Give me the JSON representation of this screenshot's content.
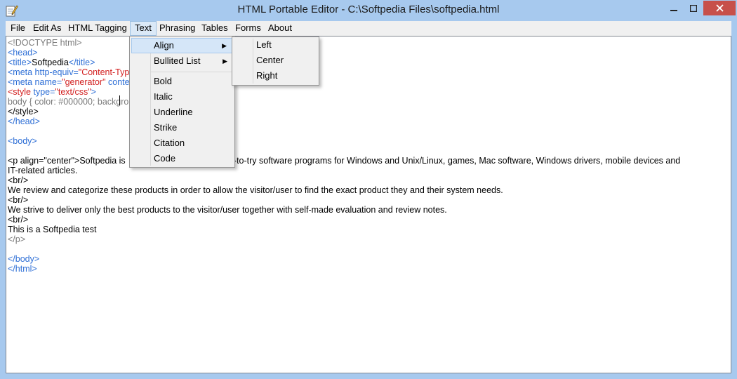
{
  "window": {
    "title": "HTML Portable Editor - C:\\Softpedia Files\\softpedia.html"
  },
  "menubar": {
    "items": [
      {
        "label": "File"
      },
      {
        "label": "Edit As"
      },
      {
        "label": "HTML Tagging"
      },
      {
        "label": "Text"
      },
      {
        "label": "Phrasing"
      },
      {
        "label": "Tables"
      },
      {
        "label": "Forms"
      },
      {
        "label": "About"
      }
    ]
  },
  "text_menu": {
    "items": [
      {
        "label": "Align",
        "arrow": "▶"
      },
      {
        "label": "Bullited List",
        "arrow": "▶"
      },
      {
        "label": "Bold"
      },
      {
        "label": "Italic"
      },
      {
        "label": "Underline"
      },
      {
        "label": "Strike"
      },
      {
        "label": "Citation"
      },
      {
        "label": "Code"
      }
    ]
  },
  "align_menu": {
    "items": [
      {
        "label": "Left"
      },
      {
        "label": "Center"
      },
      {
        "label": "Right"
      }
    ]
  },
  "editor": {
    "lines": [
      [
        {
          "t": "<!DOCTYPE html>",
          "c": "gray"
        }
      ],
      [
        {
          "t": "<head>",
          "c": "blue"
        }
      ],
      [
        {
          "t": "<title>",
          "c": "blue"
        },
        {
          "t": "Softpedia",
          "c": "black"
        },
        {
          "t": "</title>",
          "c": "blue"
        }
      ],
      [
        {
          "t": "<meta http-equiv=",
          "c": "blue"
        },
        {
          "t": "\"Content-Typ",
          "c": "red"
        }
      ],
      [
        {
          "t": "<meta name=",
          "c": "blue"
        },
        {
          "t": "\"generator\"",
          "c": "red"
        },
        {
          "t": " conter",
          "c": "blue"
        }
      ],
      [
        {
          "t": "<style ",
          "c": "red"
        },
        {
          "t": "type=",
          "c": "blue"
        },
        {
          "t": "\"text/css\"",
          "c": "red"
        },
        {
          "t": ">",
          "c": "blue"
        }
      ],
      [
        {
          "t": "body { color: #000000; backgro",
          "c": "gray"
        }
      ],
      [
        {
          "t": "</style>",
          "c": "black"
        }
      ],
      [
        {
          "t": "</head>",
          "c": "blue"
        }
      ],
      [],
      [
        {
          "t": "<body>",
          "c": "blue"
        }
      ],
      [],
      [
        {
          "t": "<p align=\"center\">Softpedia is",
          "c": "black"
        },
        {
          "t": "                        free and free-to-try software programs for Windows and Unix/Linux, games, Mac software, Windows drivers, mobile devices and",
          "c": "black"
        }
      ],
      [
        {
          "t": "IT-related articles.",
          "c": "black"
        }
      ],
      [
        {
          "t": "<br/>",
          "c": "black"
        }
      ],
      [
        {
          "t": "We review and categorize these products in order to allow the visitor/user to find the exact product they and their system needs.",
          "c": "black"
        }
      ],
      [
        {
          "t": "<br/>",
          "c": "black"
        }
      ],
      [
        {
          "t": "We strive to deliver only the best products to the visitor/user together with self-made evaluation and review notes.",
          "c": "black"
        }
      ],
      [
        {
          "t": "<br/>",
          "c": "black"
        }
      ],
      [
        {
          "t": "This is a Softpedia test",
          "c": "black"
        }
      ],
      [
        {
          "t": "</p>",
          "c": "gray"
        }
      ],
      [],
      [
        {
          "t": "</body>",
          "c": "blue"
        }
      ],
      [
        {
          "t": "</html>",
          "c": "blue"
        }
      ]
    ]
  },
  "colors": {
    "window_frame": "#a7c9ee",
    "close_button": "#c7504a",
    "tag_blue": "#2e6fd6",
    "attr_red": "#d21f1f",
    "menu_highlight": "#d5e6f8"
  },
  "icons": {
    "app": "notepad-pencil-icon",
    "minimize": "minimize-icon",
    "maximize": "maximize-icon",
    "close": "close-icon"
  }
}
